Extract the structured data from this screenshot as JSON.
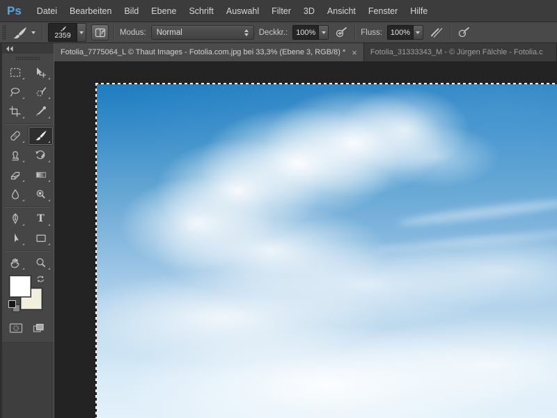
{
  "menubar": {
    "logo": "Ps",
    "items": [
      "Datei",
      "Bearbeiten",
      "Bild",
      "Ebene",
      "Schrift",
      "Auswahl",
      "Filter",
      "3D",
      "Ansicht",
      "Fenster",
      "Hilfe"
    ]
  },
  "options_bar": {
    "tool_icon": "brush-icon",
    "brush_size": "2359",
    "mode_label": "Modus:",
    "mode_value": "Normal",
    "opacity_label": "Deckkr.:",
    "opacity_value": "100%",
    "flow_label": "Fluss:",
    "flow_value": "100%",
    "icons": [
      "toggle-brush-panel-icon",
      "tablet-pressure-opacity-icon",
      "airbrush-icon",
      "tablet-pressure-size-icon"
    ]
  },
  "tabs": [
    {
      "title": "Fotolia_7775064_L © Thaut Images - Fotolia.com.jpg bei 33,3% (Ebene 3, RGB/8) *",
      "close_label": "×",
      "active": true
    },
    {
      "title": "Fotolia_31333343_M - © Jürgen Fälchle - Fotolia.c",
      "active": false
    }
  ],
  "toolbar": {
    "collapse_icon": "double-left-arrows-icon",
    "selected_tool": "brush",
    "type_tool_glyph": "T",
    "tools": [
      {
        "name": "rectangular-marquee"
      },
      {
        "name": "move"
      },
      {
        "name": "lasso"
      },
      {
        "name": "quick-selection"
      },
      {
        "name": "crop"
      },
      {
        "name": "eyedropper"
      },
      {
        "name": "spot-healing-brush"
      },
      {
        "name": "brush",
        "selected": true
      },
      {
        "name": "clone-stamp"
      },
      {
        "name": "history-brush"
      },
      {
        "name": "eraser"
      },
      {
        "name": "gradient"
      },
      {
        "name": "blur"
      },
      {
        "name": "dodge"
      },
      {
        "name": "pen"
      },
      {
        "name": "type"
      },
      {
        "name": "path-selection"
      },
      {
        "name": "rectangle-shape"
      },
      {
        "name": "hand"
      },
      {
        "name": "zoom"
      }
    ],
    "foreground_color": "#ffffff",
    "background_color": "#f1efdd"
  },
  "canvas": {
    "selection_active": true,
    "description": "Blue sky with white cumulus clouds, marching-ants selection along top and left edges",
    "sky_top_color": "#1f7dc0",
    "sky_bottom_color": "#e3f1fa"
  },
  "colors": {
    "logo_blue": "#58a7e0",
    "ui_dark": "#3c3c3c",
    "panel_gray": "#464646",
    "canvas_surround": "#232323"
  }
}
